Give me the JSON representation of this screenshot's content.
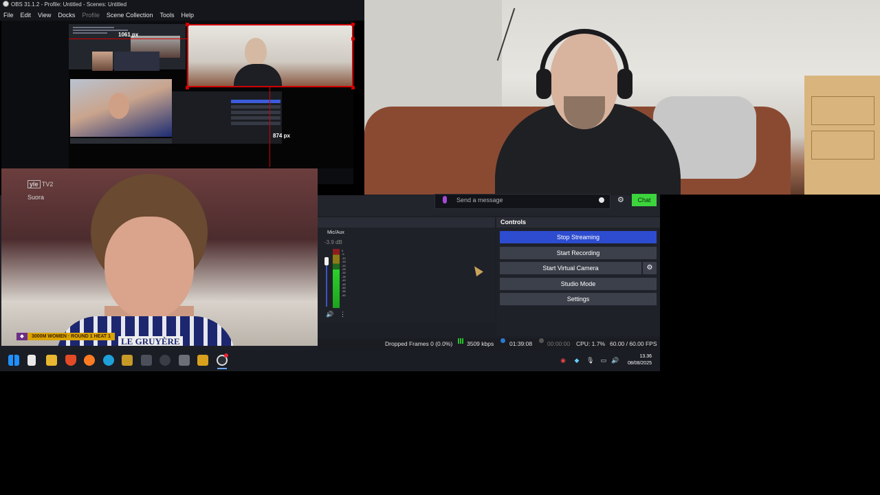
{
  "window": {
    "title": "OBS 31.1.2 - Profile: Untitled - Scenes: Untitled"
  },
  "menu": [
    "File",
    "Edit",
    "View",
    "Docks",
    "Profile",
    "Scene Collection",
    "Tools",
    "Help"
  ],
  "preview": {
    "width_label": "1061 px",
    "height_label": "874 px"
  },
  "video": {
    "channel": "TV2",
    "channel_logo": "yle",
    "live": "Suora",
    "caption": "3000M WOMEN · ROUND 1 HEAT 1",
    "sponsor": "LE GRUYÈRE"
  },
  "chat": {
    "placeholder": "Send a message",
    "button": "Chat"
  },
  "mixer": {
    "source": "Mic/Aux",
    "db": "-3.9 dB",
    "level": 0.65,
    "ticks": [
      "0",
      "-5",
      "-10",
      "-15",
      "-20",
      "-25",
      "-30",
      "-35",
      "-40",
      "-45",
      "-50",
      "-55",
      "-60"
    ]
  },
  "controls": {
    "title": "Controls",
    "stop_streaming": "Stop Streaming",
    "start_recording": "Start Recording",
    "start_virtual_camera": "Start Virtual Camera",
    "studio_mode": "Studio Mode",
    "settings": "Settings"
  },
  "status": {
    "dropped_frames": "Dropped Frames 0 (0.0%)",
    "bitrate": "3509 kbps",
    "stream_time": "01:39:08",
    "record_time": "00:00:00",
    "cpu": "CPU: 1.7%",
    "fps": "60.00 / 60.00 FPS"
  },
  "taskbar": {
    "time": "13.36",
    "date": "08/08/2025"
  },
  "colors": {
    "accent": "#2d4ccf",
    "chat_button": "#3cd43c",
    "selection": "#d10000"
  }
}
